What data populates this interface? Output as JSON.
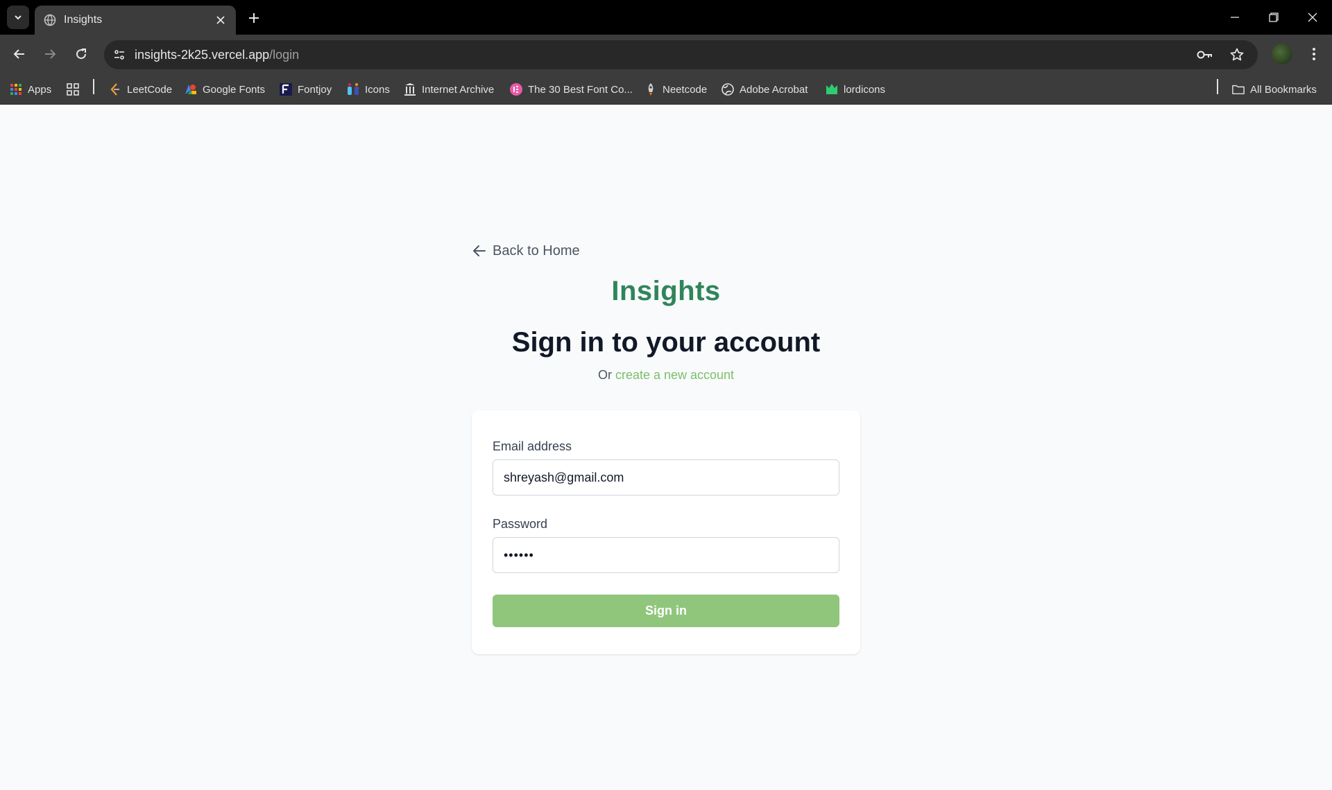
{
  "browser": {
    "tab": {
      "title": "Insights"
    },
    "url": {
      "host": "insights-2k25.vercel.app",
      "path": "/login"
    },
    "bookmarks": [
      {
        "label": "Apps",
        "icon": "apps-grid-icon"
      },
      {
        "label": "",
        "icon": "grid-icon"
      },
      {
        "label": "LeetCode",
        "icon": "leetcode-icon"
      },
      {
        "label": "Google Fonts",
        "icon": "google-fonts-icon"
      },
      {
        "label": "Fontjoy",
        "icon": "fontjoy-icon"
      },
      {
        "label": "Icons",
        "icon": "icons-icon"
      },
      {
        "label": "Internet Archive",
        "icon": "internet-archive-icon"
      },
      {
        "label": "The 30 Best Font Co...",
        "icon": "elementor-icon"
      },
      {
        "label": "Neetcode",
        "icon": "rocket-icon"
      },
      {
        "label": "Adobe Acrobat",
        "icon": "globe-icon"
      },
      {
        "label": "lordicons",
        "icon": "lordicon-icon"
      }
    ],
    "all_bookmarks_label": "All Bookmarks"
  },
  "page": {
    "back_link": "Back to Home",
    "brand": "Insights",
    "heading": "Sign in to your account",
    "subtext_prefix": "Or",
    "subtext_link": "create a new account",
    "form": {
      "email_label": "Email address",
      "email_value": "shreyash@gmail.com",
      "password_label": "Password",
      "password_value": "••••••",
      "submit_label": "Sign in"
    }
  },
  "colors": {
    "brand": "#2f855a",
    "link": "#7bbf6a",
    "button": "#90c67c",
    "heading": "#111827"
  }
}
